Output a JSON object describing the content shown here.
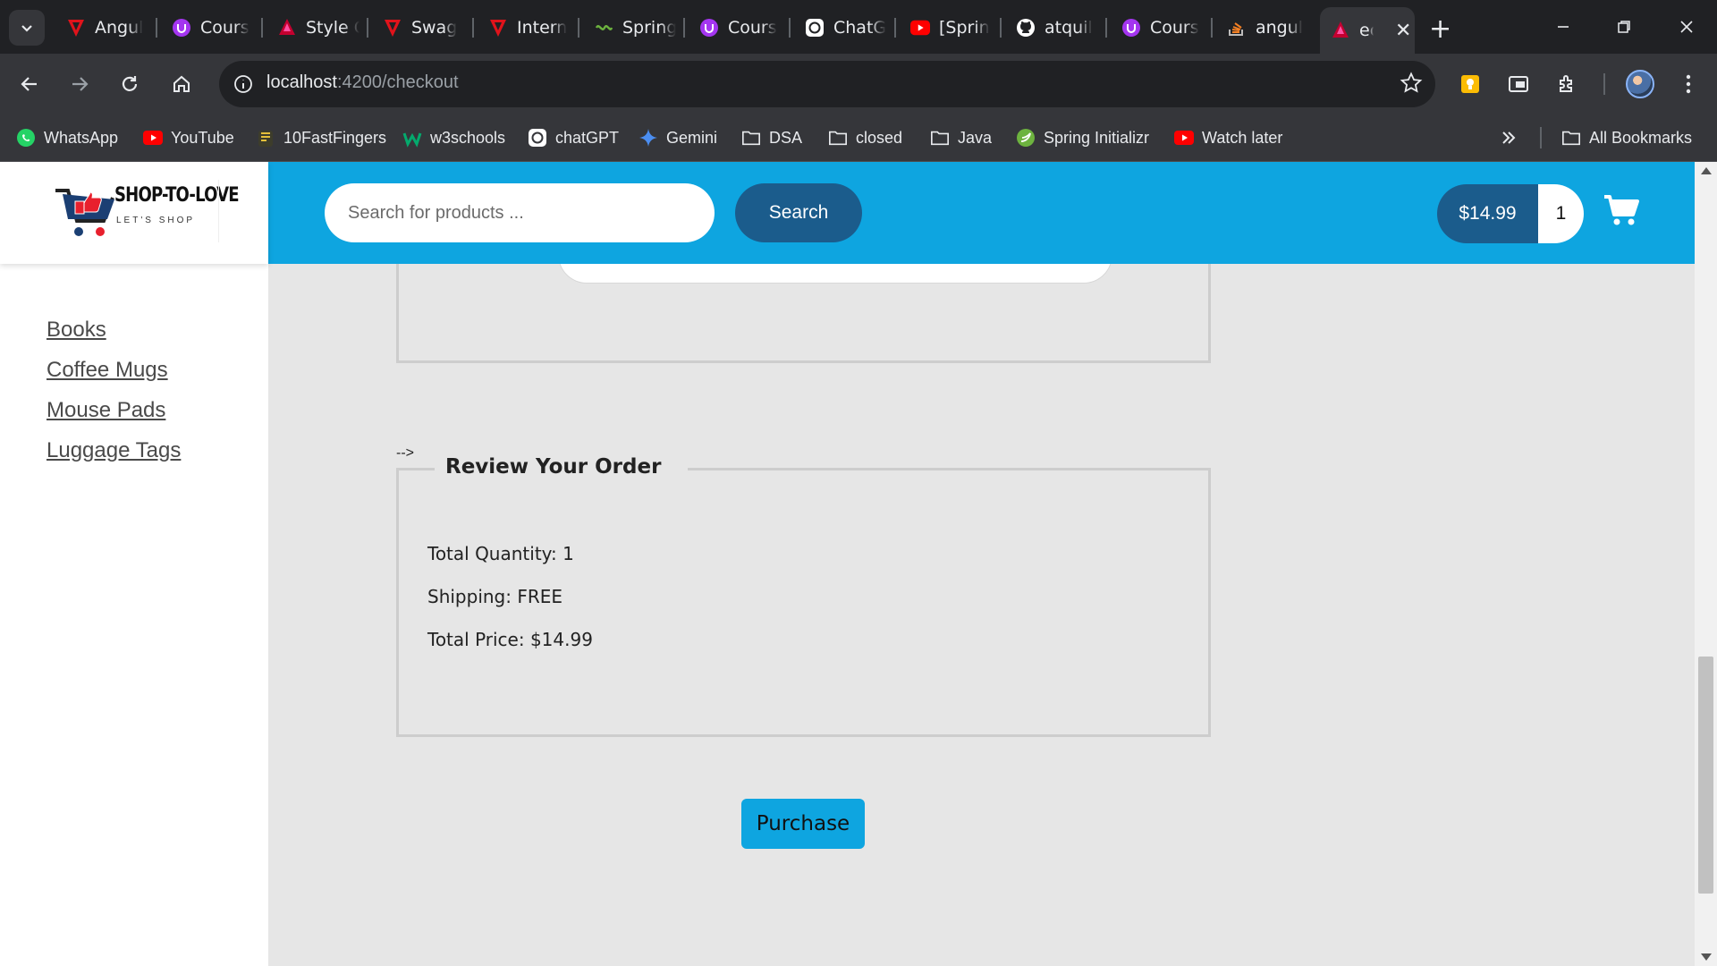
{
  "browser": {
    "tabs": [
      {
        "title": "Angul",
        "icon": "angular-red-icon"
      },
      {
        "title": "Cours",
        "icon": "udemy-icon"
      },
      {
        "title": "Style G",
        "icon": "angular-icon"
      },
      {
        "title": "Swag",
        "icon": "angular-red-icon"
      },
      {
        "title": "Intern",
        "icon": "angular-red-icon"
      },
      {
        "title": "Spring",
        "icon": "spring-icon"
      },
      {
        "title": "Cours",
        "icon": "udemy-icon"
      },
      {
        "title": "ChatG",
        "icon": "chatgpt-icon"
      },
      {
        "title": "[Sprin",
        "icon": "youtube-icon"
      },
      {
        "title": "atquil",
        "icon": "github-icon"
      },
      {
        "title": "Cours",
        "icon": "udemy-icon"
      },
      {
        "title": "angul",
        "icon": "stackoverflow-icon"
      },
      {
        "title": "ec",
        "icon": "angular-icon",
        "active": true
      }
    ],
    "address": {
      "host": "localhost",
      "path": ":4200/checkout"
    },
    "bookmarks": [
      {
        "label": "WhatsApp",
        "icon": "whatsapp-icon"
      },
      {
        "label": "YouTube",
        "icon": "youtube-icon"
      },
      {
        "label": "10FastFingers",
        "icon": "fastfingers-icon"
      },
      {
        "label": "w3schools",
        "icon": "w3schools-icon"
      },
      {
        "label": "chatGPT",
        "icon": "chatgpt-icon"
      },
      {
        "label": "Gemini",
        "icon": "gemini-icon"
      },
      {
        "label": "DSA",
        "icon": "folder-icon"
      },
      {
        "label": "closed",
        "icon": "folder-icon"
      },
      {
        "label": "Java",
        "icon": "folder-icon"
      },
      {
        "label": "Spring Initializr",
        "icon": "spring-icon"
      },
      {
        "label": "Watch later",
        "icon": "youtube-icon"
      },
      {
        "label": "All Bookmarks",
        "icon": "folder-icon"
      }
    ]
  },
  "app": {
    "brand": {
      "name": "SHOP-TO-LOVE",
      "tagline": "LET'S SHOP"
    },
    "categories": [
      "Books",
      "Coffee Mugs",
      "Mouse Pads",
      "Luggage Tags"
    ],
    "search": {
      "placeholder": "Search for products ...",
      "button": "Search"
    },
    "cart": {
      "total": "$14.99",
      "quantity": "1"
    },
    "colors": {
      "header": "#0ea5e0",
      "dark_button": "#1b5c8c"
    }
  },
  "checkout": {
    "comment_artifact": "-->",
    "review": {
      "legend": "Review Your Order",
      "total_quantity": "Total Quantity: 1",
      "shipping": "Shipping: FREE",
      "total_price": "Total Price: $14.99"
    },
    "purchase_button": "Purchase"
  }
}
